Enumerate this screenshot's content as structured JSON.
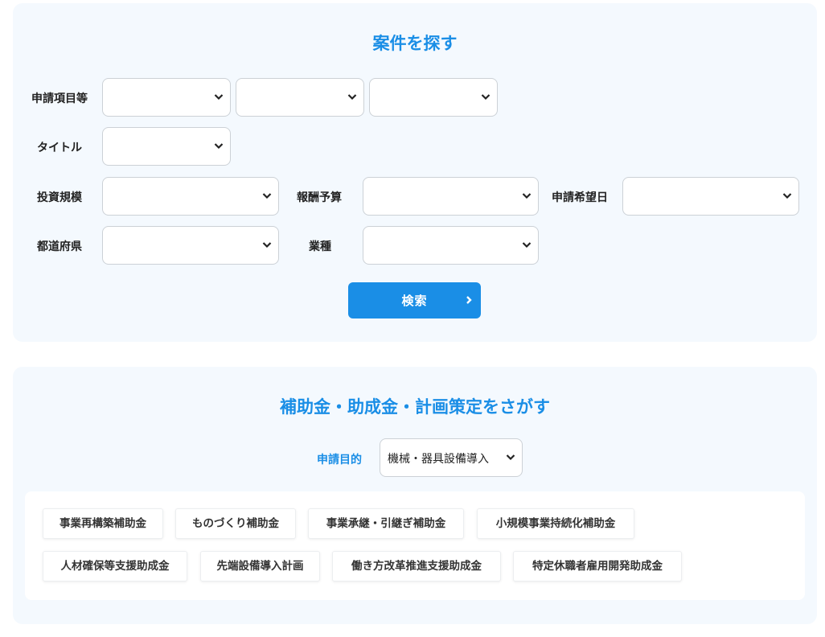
{
  "search_section": {
    "title": "案件を探す",
    "labels": {
      "application_items": "申請項目等",
      "title": "タイトル",
      "investment_scale": "投資規模",
      "reward_budget": "報酬予算",
      "desired_date": "申請希望日",
      "prefecture": "都道府県",
      "industry": "業種"
    },
    "values": {
      "application_item_1": "",
      "application_item_2": "",
      "application_item_3": "",
      "title": "",
      "investment_scale": "",
      "reward_budget": "",
      "desired_date": "",
      "prefecture": "",
      "industry": ""
    },
    "search_button": "検索"
  },
  "subsidy_section": {
    "title": "補助金・助成金・計画策定をさがす",
    "purpose_label": "申請目的",
    "purpose_value": "機械・器具設備導入",
    "tags": [
      "事業再構築補助金",
      "ものづくり補助金",
      "事業承継・引継ぎ補助金",
      "小規模事業持続化補助金",
      "人材確保等支援助成金",
      "先端設備導入計画",
      "働き方改革推進支援助成金",
      "特定休職者雇用開発助成金"
    ]
  },
  "colors": {
    "accent": "#1a8ee6",
    "panel_bg": "#f4f9fe"
  }
}
